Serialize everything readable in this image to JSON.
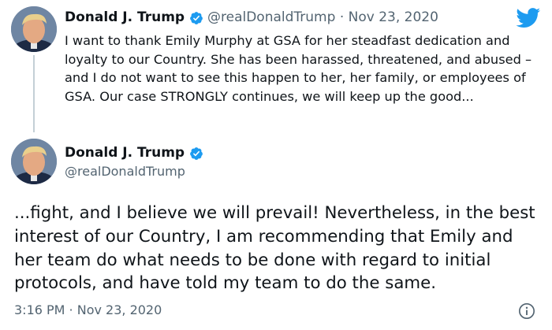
{
  "tweet1": {
    "author_name": "Donald J. Trump",
    "handle": "@realDonaldTrump",
    "separator": "·",
    "date": "Nov 23, 2020",
    "text": "I want to thank Emily Murphy at GSA for her steadfast dedication and loyalty to our Country. She has been harassed, threatened, and abused – and I do not want to see this happen to her, her family, or employees of GSA. Our case STRONGLY continues, we will keep up the good..."
  },
  "tweet2": {
    "author_name": "Donald J. Trump",
    "handle": "@realDonaldTrump",
    "text": "...fight, and I believe we will prevail! Nevertheless, in the best interest of our Country, I am recommending that Emily and her team do what needs to be done with regard to initial protocols, and have told my team to do the same.",
    "timestamp": "3:16 PM · Nov 23, 2020"
  },
  "icons": {
    "brand": "twitter-bird-icon",
    "verified": "verified-badge-icon",
    "info": "info-icon"
  },
  "colors": {
    "twitter_blue": "#1d9bf0",
    "text": "#0f1419",
    "muted": "#536471",
    "thread_line": "#c4cfd6"
  }
}
